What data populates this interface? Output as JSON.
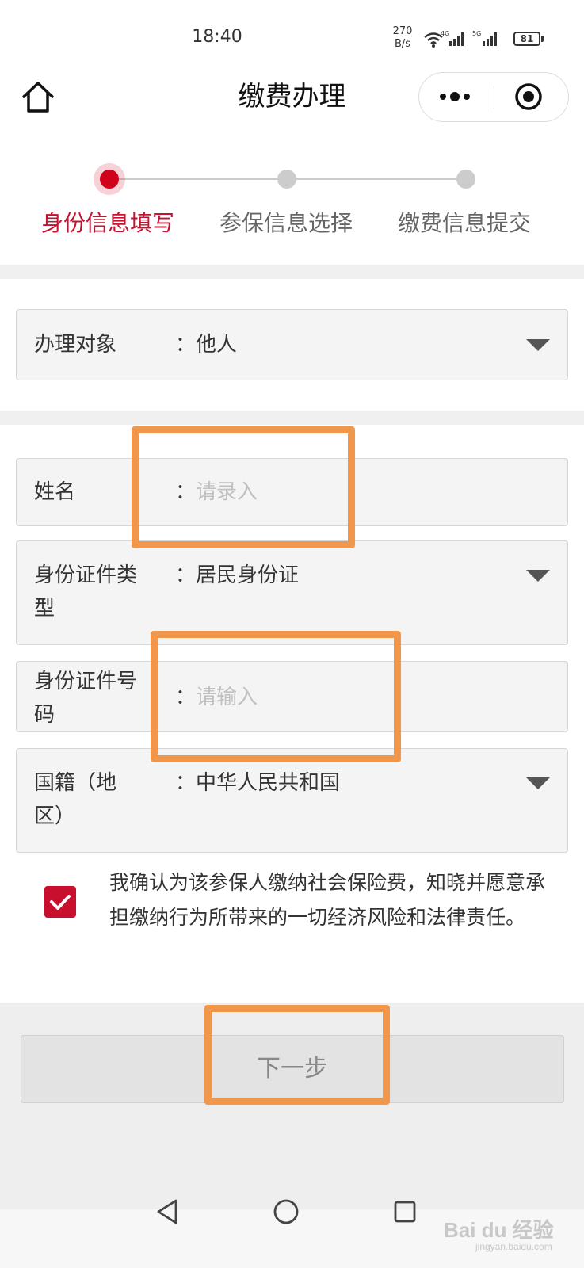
{
  "status_bar": {
    "time": "18:40",
    "net_speed_value": "270",
    "net_speed_unit": "B/s",
    "signal1_label": "4G",
    "signal2_label": "5G",
    "battery": "81"
  },
  "nav": {
    "title": "缴费办理",
    "home_icon": "home-icon",
    "more_icon": "more-dots-icon",
    "close_icon": "target-close-icon"
  },
  "steps": [
    {
      "label": "身份信息填写",
      "active": true
    },
    {
      "label": "参保信息选择",
      "active": false
    },
    {
      "label": "缴费信息提交",
      "active": false
    }
  ],
  "form": {
    "object": {
      "label": "办理对象",
      "colon": "：",
      "value": "他人"
    },
    "name": {
      "label": "姓名",
      "colon": "：",
      "placeholder": "请录入"
    },
    "id_type": {
      "label_line1": "身份证件类",
      "label_line2": "型",
      "colon": "：",
      "value": "居民身份证"
    },
    "id_number": {
      "label_line1": "身份证件号",
      "label_line2": "码",
      "colon": "：",
      "placeholder": "请输入"
    },
    "nationality": {
      "label_line1": "国籍（地",
      "label_line2": "区）",
      "colon": "：",
      "value": "中华人民共和国"
    }
  },
  "agreement": {
    "checked": true,
    "text": "我确认为该参保人缴纳社会保险费，知晓并愿意承担缴纳行为所带来的一切经济风险和法律责任。"
  },
  "next_button": {
    "label": "下一步"
  },
  "watermark": {
    "text": "Bai du 经验",
    "sub": "jingyan.baidu.com"
  },
  "colors": {
    "accent": "#c8102e",
    "highlight": "#f0974b"
  }
}
